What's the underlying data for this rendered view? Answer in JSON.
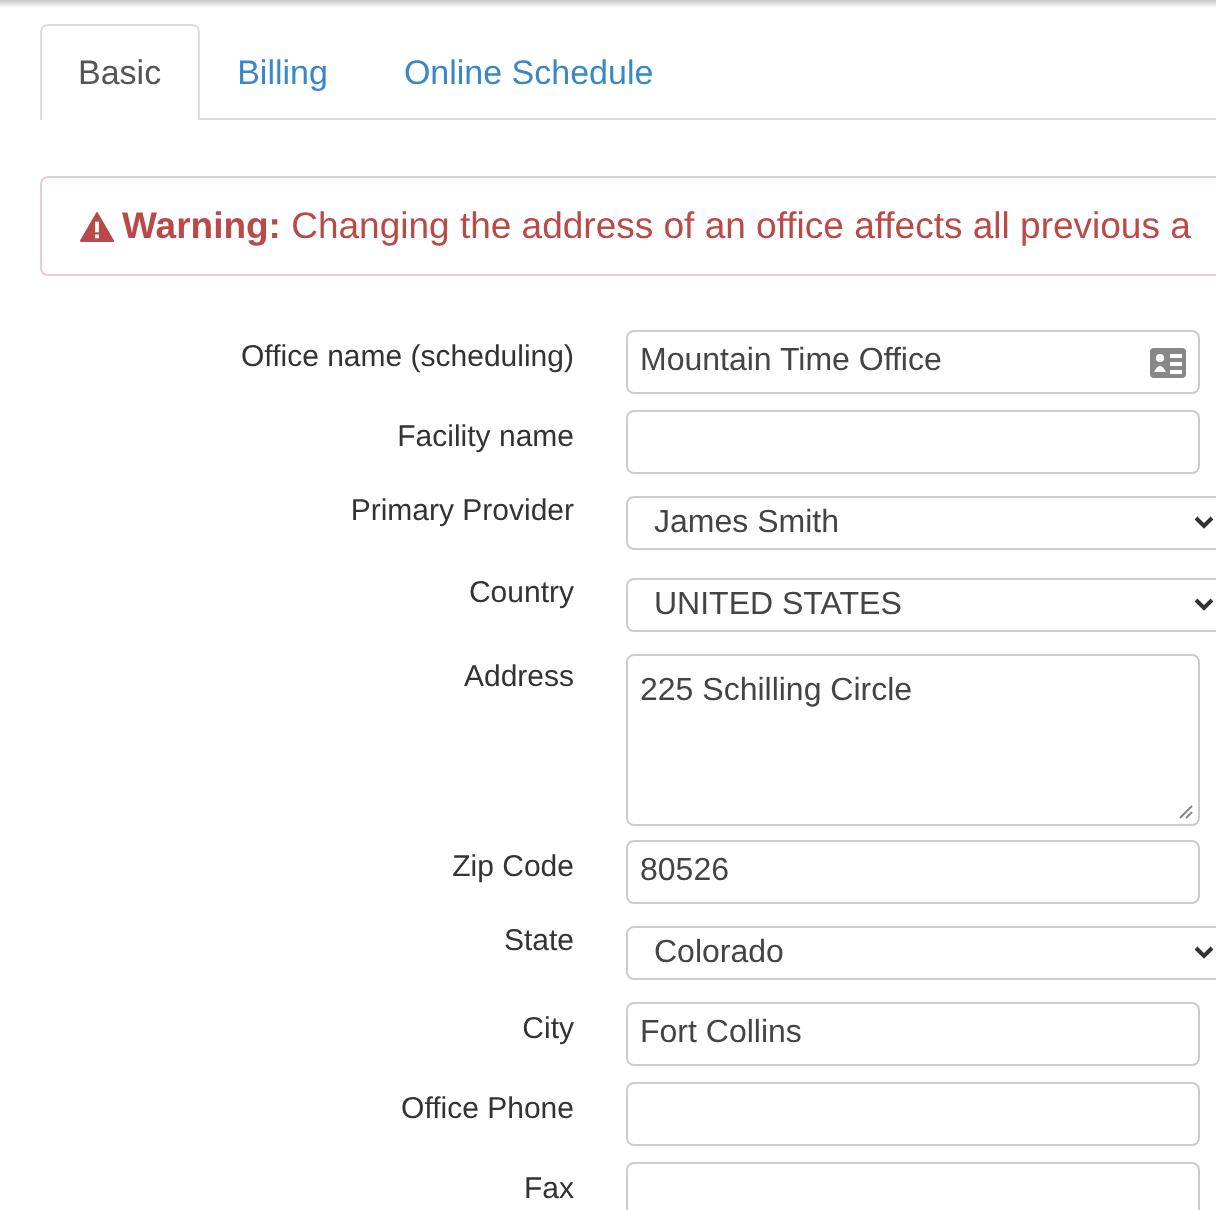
{
  "tabs": [
    {
      "label": "Basic",
      "selected": true
    },
    {
      "label": "Billing",
      "selected": false
    },
    {
      "label": "Online Schedule",
      "selected": false
    }
  ],
  "warning": {
    "text": "**Warning:** Changing the address of an office affects all previous a"
  },
  "fields": [
    {
      "label": "Office name (scheduling)",
      "kind": "text",
      "value": "Mountain Time Office",
      "card_icon": true
    },
    {
      "label": "Facility name",
      "kind": "text"
    },
    {
      "label": "Primary Provider",
      "kind": "select",
      "value": "James Smith"
    },
    {
      "label": "Country",
      "kind": "select",
      "value": "UNITED STATES"
    },
    {
      "label": "Address",
      "kind": "textarea",
      "value": "225 Schilling Circle"
    },
    {
      "label": "Zip Code",
      "kind": "text",
      "value": "80526"
    },
    {
      "label": "State",
      "kind": "select",
      "value": "Colorado"
    },
    {
      "label": "City",
      "kind": "text",
      "value": "Fort Collins"
    },
    {
      "label": "Office Phone",
      "kind": "text"
    },
    {
      "label": "Fax",
      "kind": "text"
    }
  ]
}
